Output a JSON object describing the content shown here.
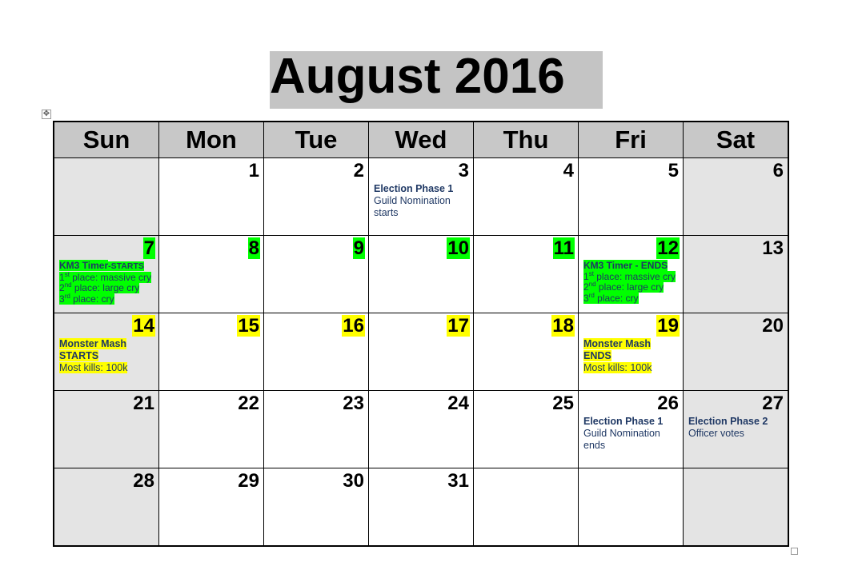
{
  "title": "August 2016",
  "colors": {
    "header_bg": "#c8c8c8",
    "weekend_bg": "#e4e4e4",
    "highlight_green": "#00ff00",
    "highlight_yellow": "#ffff00",
    "event_text": "#1f3864"
  },
  "weekdays": [
    "Sun",
    "Mon",
    "Tue",
    "Wed",
    "Thu",
    "Fri",
    "Sat"
  ],
  "weeks": [
    [
      {
        "day": ""
      },
      {
        "day": "1"
      },
      {
        "day": "2"
      },
      {
        "day": "3",
        "events": [
          {
            "title": "Election Phase 1",
            "lines": [
              "Guild Nomination",
              "starts"
            ]
          }
        ]
      },
      {
        "day": "4"
      },
      {
        "day": "5"
      },
      {
        "day": "6"
      }
    ],
    [
      {
        "day": "7",
        "highlight": "green",
        "events": [
          {
            "title": "KM3 Timer",
            "title_suffix": "-STARTS",
            "places": [
              {
                "ord": "1",
                "sup": "st",
                "text": " place: massive cry"
              },
              {
                "ord": "2",
                "sup": "nd",
                "text": " place: large cry"
              },
              {
                "ord": "3",
                "sup": "rd",
                "text": " place: cry"
              }
            ]
          }
        ]
      },
      {
        "day": "8",
        "highlight": "green"
      },
      {
        "day": "9",
        "highlight": "green"
      },
      {
        "day": "10",
        "highlight": "green"
      },
      {
        "day": "11",
        "highlight": "green"
      },
      {
        "day": "12",
        "highlight": "green",
        "events": [
          {
            "title": "KM3 Timer - ENDS",
            "places": [
              {
                "ord": "1",
                "sup": "st",
                "text": " place: massive cry"
              },
              {
                "ord": "2",
                "sup": "nd",
                "text": " place: large cry"
              },
              {
                "ord": "3",
                "sup": "rd",
                "text": " place: cry"
              }
            ]
          }
        ]
      },
      {
        "day": "13"
      }
    ],
    [
      {
        "day": "14",
        "highlight": "yellow",
        "events": [
          {
            "title": "Monster Mash",
            "title2": "STARTS",
            "lines": [
              "Most kills: 100k"
            ]
          }
        ]
      },
      {
        "day": "15",
        "highlight": "yellow"
      },
      {
        "day": "16",
        "highlight": "yellow"
      },
      {
        "day": "17",
        "highlight": "yellow"
      },
      {
        "day": "18",
        "highlight": "yellow"
      },
      {
        "day": "19",
        "highlight": "yellow",
        "events": [
          {
            "title": "Monster Mash",
            "title2": "ENDS",
            "lines": [
              "Most kills: 100k"
            ]
          }
        ]
      },
      {
        "day": "20"
      }
    ],
    [
      {
        "day": "21"
      },
      {
        "day": "22"
      },
      {
        "day": "23"
      },
      {
        "day": "24"
      },
      {
        "day": "25"
      },
      {
        "day": "26",
        "events": [
          {
            "title": "Election Phase 1",
            "lines": [
              "Guild Nomination",
              "ends"
            ]
          }
        ]
      },
      {
        "day": "27",
        "events": [
          {
            "title": "Election Phase 2",
            "lines": [
              "Officer votes"
            ]
          }
        ]
      }
    ],
    [
      {
        "day": "28"
      },
      {
        "day": "29"
      },
      {
        "day": "30"
      },
      {
        "day": "31"
      },
      {
        "day": ""
      },
      {
        "day": ""
      },
      {
        "day": ""
      }
    ]
  ]
}
